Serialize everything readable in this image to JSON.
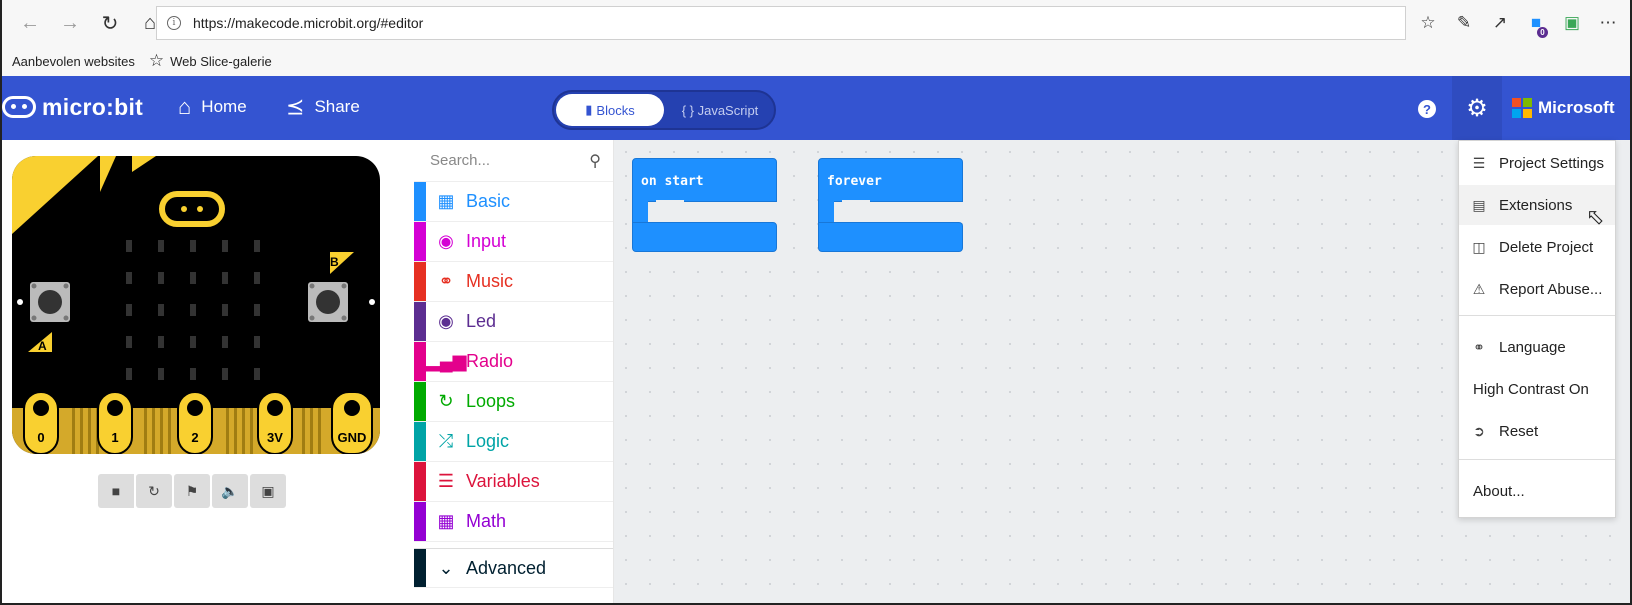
{
  "browser": {
    "url": "https://makecode.microbit.org/#editor",
    "favorites": [
      "Aanbevolen websites",
      "Web Slice-galerie"
    ],
    "badge_count": "0"
  },
  "header": {
    "brand": "micro:bit",
    "home_label": "Home",
    "share_label": "Share",
    "blocks_label": "Blocks",
    "javascript_label": "{ } JavaScript",
    "help_icon": "?",
    "microsoft_label": "Microsoft",
    "microsoft_colors": [
      "#f25022",
      "#7fba00",
      "#00a4ef",
      "#ffb900"
    ]
  },
  "simulator": {
    "pins": [
      "0",
      "1",
      "2",
      "3V",
      "GND"
    ],
    "button_a": "A",
    "button_b": "B"
  },
  "toolbox": {
    "search_placeholder": "Search...",
    "categories": [
      {
        "label": "Basic",
        "color": "#1e90ff",
        "icon": "grid-icon"
      },
      {
        "label": "Input",
        "color": "#d400d4",
        "icon": "target-icon"
      },
      {
        "label": "Music",
        "color": "#e63022",
        "icon": "headphones-icon"
      },
      {
        "label": "Led",
        "color": "#5c2d91",
        "icon": "toggle-icon"
      },
      {
        "label": "Radio",
        "color": "#e3008c",
        "icon": "signal-icon"
      },
      {
        "label": "Loops",
        "color": "#00aa00",
        "icon": "refresh-icon"
      },
      {
        "label": "Logic",
        "color": "#00a4a6",
        "icon": "shuffle-icon"
      },
      {
        "label": "Variables",
        "color": "#dc143c",
        "icon": "lines-icon"
      },
      {
        "label": "Math",
        "color": "#9400d3",
        "icon": "calculator-icon"
      }
    ],
    "advanced_label": "Advanced",
    "advanced_color": "#002030"
  },
  "workspace": {
    "blocks": [
      {
        "label": "on start"
      },
      {
        "label": "forever"
      }
    ]
  },
  "menu": {
    "items": [
      {
        "label": "Project Settings",
        "icon": "sliders-icon"
      },
      {
        "label": "Extensions",
        "icon": "drive-icon"
      },
      {
        "label": "Delete Project",
        "icon": "trash-icon"
      },
      {
        "label": "Report Abuse...",
        "icon": "alert-icon"
      },
      {
        "label": "Language",
        "icon": "globe-icon"
      },
      {
        "label": "High Contrast On",
        "icon": ""
      },
      {
        "label": "Reset",
        "icon": "signout-icon"
      },
      {
        "label": "About...",
        "icon": ""
      }
    ]
  }
}
